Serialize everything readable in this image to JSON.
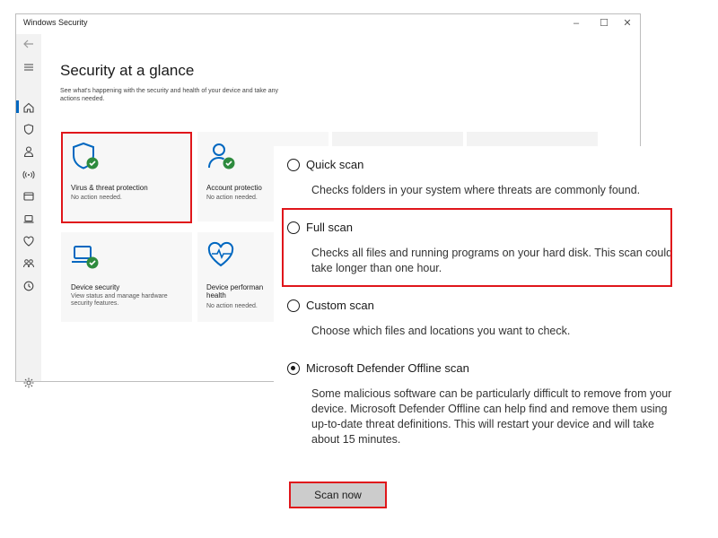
{
  "window": {
    "title": "Windows Security",
    "controls": {
      "minimize": "–",
      "maximize": "☐",
      "close": "✕"
    }
  },
  "sidebar": {
    "back_icon": "back-arrow-icon",
    "items": [
      {
        "icon": "hamburger-menu-icon"
      },
      {
        "icon": "home-icon",
        "active": true
      },
      {
        "icon": "shield-icon"
      },
      {
        "icon": "person-icon"
      },
      {
        "icon": "wifi-signal-icon"
      },
      {
        "icon": "app-browser-icon"
      },
      {
        "icon": "laptop-icon"
      },
      {
        "icon": "heart-health-icon"
      },
      {
        "icon": "family-icon"
      },
      {
        "icon": "history-icon"
      }
    ],
    "settings_icon": "gear-icon"
  },
  "main": {
    "heading": "Security at a glance",
    "subtext": "See what's happening with the security and health of your device and take any actions needed.",
    "cards": [
      {
        "title": "Virus & threat protection",
        "status": "No action needed."
      },
      {
        "title": "Account protectio",
        "status": "No action needed."
      },
      {
        "title": "Device security",
        "status": "View status and manage hardware security features."
      },
      {
        "title": "Device performan health",
        "status": "No action needed."
      }
    ]
  },
  "scan_options": [
    {
      "label": "Quick scan",
      "selected": false,
      "description": "Checks folders in your system where threats are commonly found."
    },
    {
      "label": "Full scan",
      "selected": false,
      "description": "Checks all files and running programs on your hard disk. This scan could take longer than one hour."
    },
    {
      "label": "Custom scan",
      "selected": false,
      "description": "Choose which files and locations you want to check."
    },
    {
      "label": "Microsoft Defender Offline scan",
      "selected": true,
      "description": "Some malicious software can be particularly difficult to remove from your device. Microsoft Defender Offline can help find and remove them using up-to-date threat definitions. This will restart your device and will take about 15 minutes."
    }
  ],
  "scan_button": "Scan now",
  "colors": {
    "accent": "#0067c0",
    "highlight": "#e0161b",
    "ok_green": "#2e8b3e",
    "icon_blue": "#0067c0"
  }
}
